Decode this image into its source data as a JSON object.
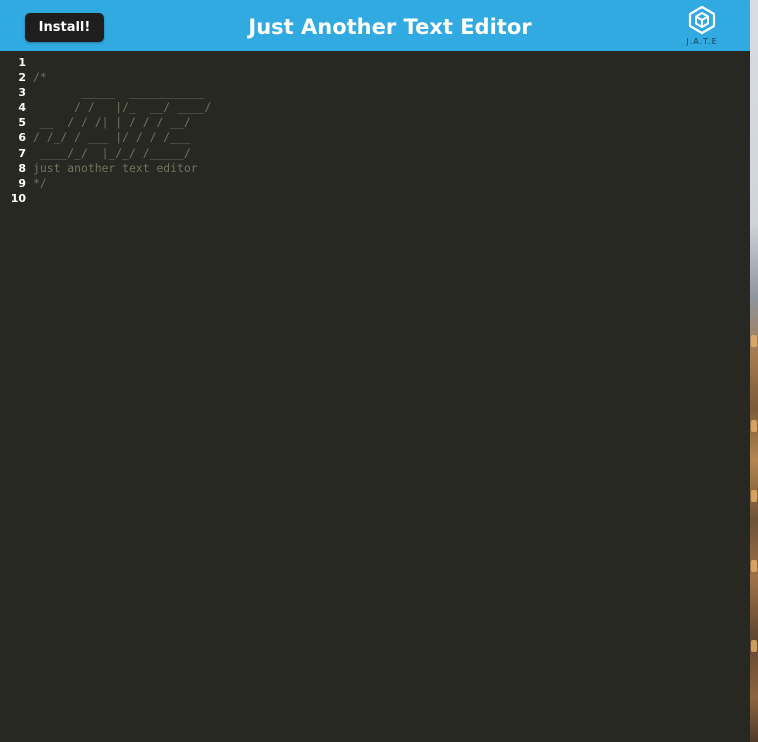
{
  "header": {
    "install_label": "Install!",
    "title": "Just Another Text Editor",
    "logo_text": "J.A.T.E",
    "background": "#31a9e1"
  },
  "editor": {
    "background": "#272822",
    "comment_color": "#75715e",
    "line_numbers": [
      "1",
      "2",
      "3",
      "4",
      "5",
      "6",
      "7",
      "8",
      "9",
      "10"
    ],
    "lines": [
      "",
      "/*",
      "       _____  ___________",
      "      / /   |/_  __/ ____/",
      " __  / / /| | / / / __/",
      "/ /_/ / ___ |/ / / /___",
      " ____/_/  |_/_/ /_____/",
      "just another text editor",
      "*/",
      ""
    ]
  }
}
